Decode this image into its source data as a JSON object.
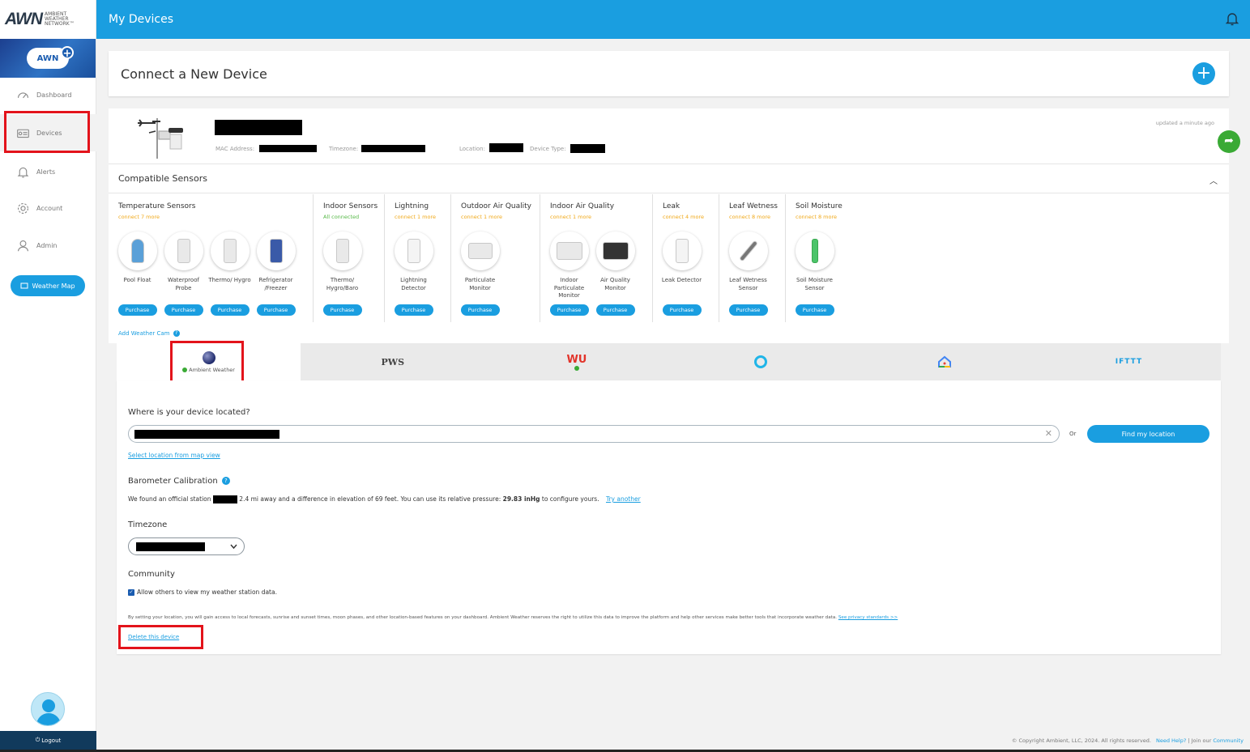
{
  "logo": {
    "mark": "AWN",
    "text_line1": "AMBIENT",
    "text_line2": "WEATHER",
    "text_line3": "NETWORK™",
    "plus_badge": "AWN"
  },
  "nav": {
    "dashboard": "Dashboard",
    "devices": "Devices",
    "alerts": "Alerts",
    "account": "Account",
    "admin": "Admin",
    "weather_map": "Weather Map",
    "logout": "Logout"
  },
  "header": {
    "title": "My Devices"
  },
  "connect": {
    "title": "Connect a New Device",
    "add_symbol": "+"
  },
  "device": {
    "mac_label": "MAC Address:",
    "timezone_label": "Timezone:",
    "location_label": "Location:",
    "device_type_label": "Device Type:",
    "updated": "updated a minute ago"
  },
  "sensors": {
    "title": "Compatible Sensors",
    "groups": [
      {
        "title": "Temperature Sensors",
        "status": "connect 7 more",
        "items": [
          {
            "name": "Pool Float"
          },
          {
            "name": "Waterproof Probe"
          },
          {
            "name": "Thermo/ Hygro"
          },
          {
            "name": "Refrigerator /Freezer"
          }
        ]
      },
      {
        "title": "Indoor Sensors",
        "status": "All connected",
        "items": [
          {
            "name": "Thermo/ Hygro/Baro"
          }
        ]
      },
      {
        "title": "Lightning",
        "status": "connect 1 more",
        "items": [
          {
            "name": "Lightning Detector"
          }
        ]
      },
      {
        "title": "Outdoor Air Quality",
        "status": "connect 1 more",
        "items": [
          {
            "name": "Particulate Monitor"
          }
        ]
      },
      {
        "title": "Indoor Air Quality",
        "status": "connect 1 more",
        "items": [
          {
            "name": "Indoor Particulate Monitor"
          },
          {
            "name": "Air Quality Monitor"
          }
        ]
      },
      {
        "title": "Leak",
        "status": "connect 4 more",
        "items": [
          {
            "name": "Leak Detector"
          }
        ]
      },
      {
        "title": "Leaf Wetness",
        "status": "connect 8 more",
        "items": [
          {
            "name": "Leaf Wetness Sensor"
          }
        ]
      },
      {
        "title": "Soil Moisture",
        "status": "connect 8 more",
        "items": [
          {
            "name": "Soil Moisture Sensor"
          }
        ]
      }
    ],
    "purchase_label": "Purchase",
    "add_weather_cam": "Add Weather Cam"
  },
  "integrations": {
    "ambient": "Ambient Weather",
    "pws": "PWS",
    "wu": "WU",
    "ifttt": "IFTTT"
  },
  "settings": {
    "location_question": "Where is your device located?",
    "or": "Or",
    "find_location": "Find my location",
    "select_from_map": "Select location from map view",
    "baro_title": "Barometer Calibration",
    "baro_text_1": "We found an official station",
    "baro_text_2": "2.4 mi away and a difference in elevation of 69 feet. You can use its relative pressure:",
    "baro_pressure": "29.83 inHg",
    "baro_text_3": "to configure yours.",
    "try_another": "Try another",
    "timezone_title": "Timezone",
    "community_title": "Community",
    "allow_others": "Allow others to view my weather station data.",
    "fine_print": "By setting your location, you will gain access to local forecasts, sunrise and sunset times, moon phases, and other location-based features on your dashboard. Ambient Weather reserves the right to utilize this data to improve the platform and help other services make better tools that incorporate weather data.",
    "privacy_link": "See privacy standards >>",
    "delete_device": "Delete this device"
  },
  "footer": {
    "copyright": "© Copyright Ambient, LLC, 2024. All rights reserved.",
    "need_help": "Need Help?",
    "join": "| Join our",
    "community": "Community"
  },
  "colors": {
    "primary": "#1a9ee0",
    "highlight_box": "#e3131b",
    "warning": "#f0a818",
    "success": "#3aaa35"
  }
}
